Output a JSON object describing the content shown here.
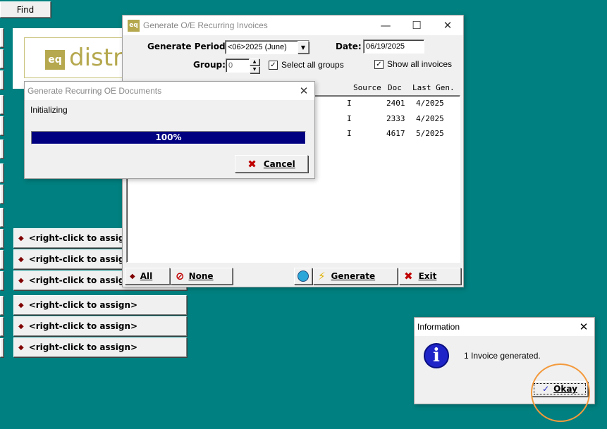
{
  "toolbar": {
    "find_label": "Find"
  },
  "logo": {
    "badge": "eq",
    "text": "distr"
  },
  "shortcuts": [
    "<right-click to assign>",
    "<right-click to assign>",
    "<right-click to assign>",
    "<right-click to assign>",
    "<right-click to assign>",
    "<right-click to assign>"
  ],
  "main_window": {
    "icon": "eq",
    "title": "Generate O/E Recurring Invoices",
    "generate_period_label": "Generate Period:",
    "generate_period_value": "<06>2025 (June)",
    "date_label": "Date:",
    "date_value": "06/19/2025",
    "group_label": "Group:",
    "group_value": "0",
    "select_all_groups_label": "Select all groups",
    "show_all_invoices_label": "Show all invoices",
    "columns": [
      "Source",
      "Doc",
      "Last Gen."
    ],
    "rows": [
      {
        "source": "I",
        "doc": "2401",
        "last_gen": "4/2025"
      },
      {
        "source": "I",
        "doc": "2333",
        "last_gen": "4/2025"
      },
      {
        "source": "I",
        "doc": "4617",
        "last_gen": "5/2025"
      }
    ],
    "buttons": {
      "all": "All",
      "none": "None",
      "generate": "Generate",
      "exit": "Exit"
    }
  },
  "progress_dialog": {
    "title": "Generate Recurring OE Documents",
    "status": "Initializing",
    "progress_text": "100%",
    "progress": 100,
    "cancel_label": "Cancel"
  },
  "info_dialog": {
    "title": "Information",
    "message": "1 Invoice generated.",
    "okay_label": "Okay"
  },
  "colors": {
    "background": "#008080",
    "progress_fill": "#000080",
    "shortcut_diamond": "#800000",
    "annotation_circle": "#f39a3c"
  }
}
